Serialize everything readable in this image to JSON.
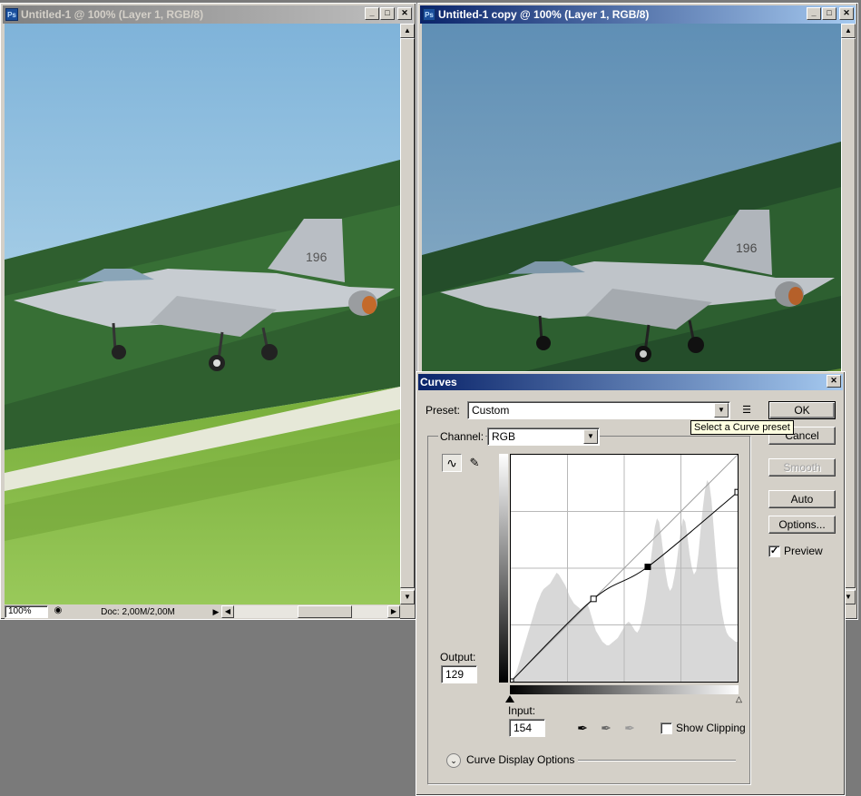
{
  "doc1": {
    "title": "Untitled-1 @ 100% (Layer 1, RGB/8)",
    "zoom": "100%",
    "doc_info": "Doc: 2,00M/2,00M",
    "aircraft_number": "196"
  },
  "doc2": {
    "title": "Untitled-1 copy @ 100% (Layer 1, RGB/8)",
    "aircraft_number": "196"
  },
  "app_icon": "Ps",
  "curves": {
    "title": "Curves",
    "preset_label": "Preset:",
    "preset_value": "Custom",
    "preset_tooltip": "Select a Curve preset",
    "channel_label": "Channel:",
    "channel_value": "RGB",
    "output_label": "Output:",
    "output_value": "129",
    "input_label": "Input:",
    "input_value": "154",
    "show_clipping_label": "Show Clipping",
    "curve_display_options_label": "Curve Display Options",
    "buttons": {
      "ok": "OK",
      "cancel": "Cancel",
      "smooth": "Smooth",
      "auto": "Auto",
      "options": "Options..."
    },
    "preview_label": "Preview",
    "preview_checked": true,
    "show_clipping_checked": false,
    "control_points": [
      {
        "input": 0,
        "output": 0
      },
      {
        "input": 93,
        "output": 93
      },
      {
        "input": 154,
        "output": 129
      },
      {
        "input": 255,
        "output": 213
      }
    ]
  },
  "icons": {
    "close": "close-icon",
    "minimize": "minimize-icon",
    "maximize": "maximize-icon",
    "curve_tool": "curve-point-icon",
    "pencil_tool": "pencil-icon",
    "preset_menu": "preset-options-icon",
    "eyedropper_black": "black-eyedropper-icon",
    "eyedropper_gray": "gray-eyedropper-icon",
    "eyedropper_white": "white-eyedropper-icon",
    "expand": "chevron-down-icon"
  }
}
